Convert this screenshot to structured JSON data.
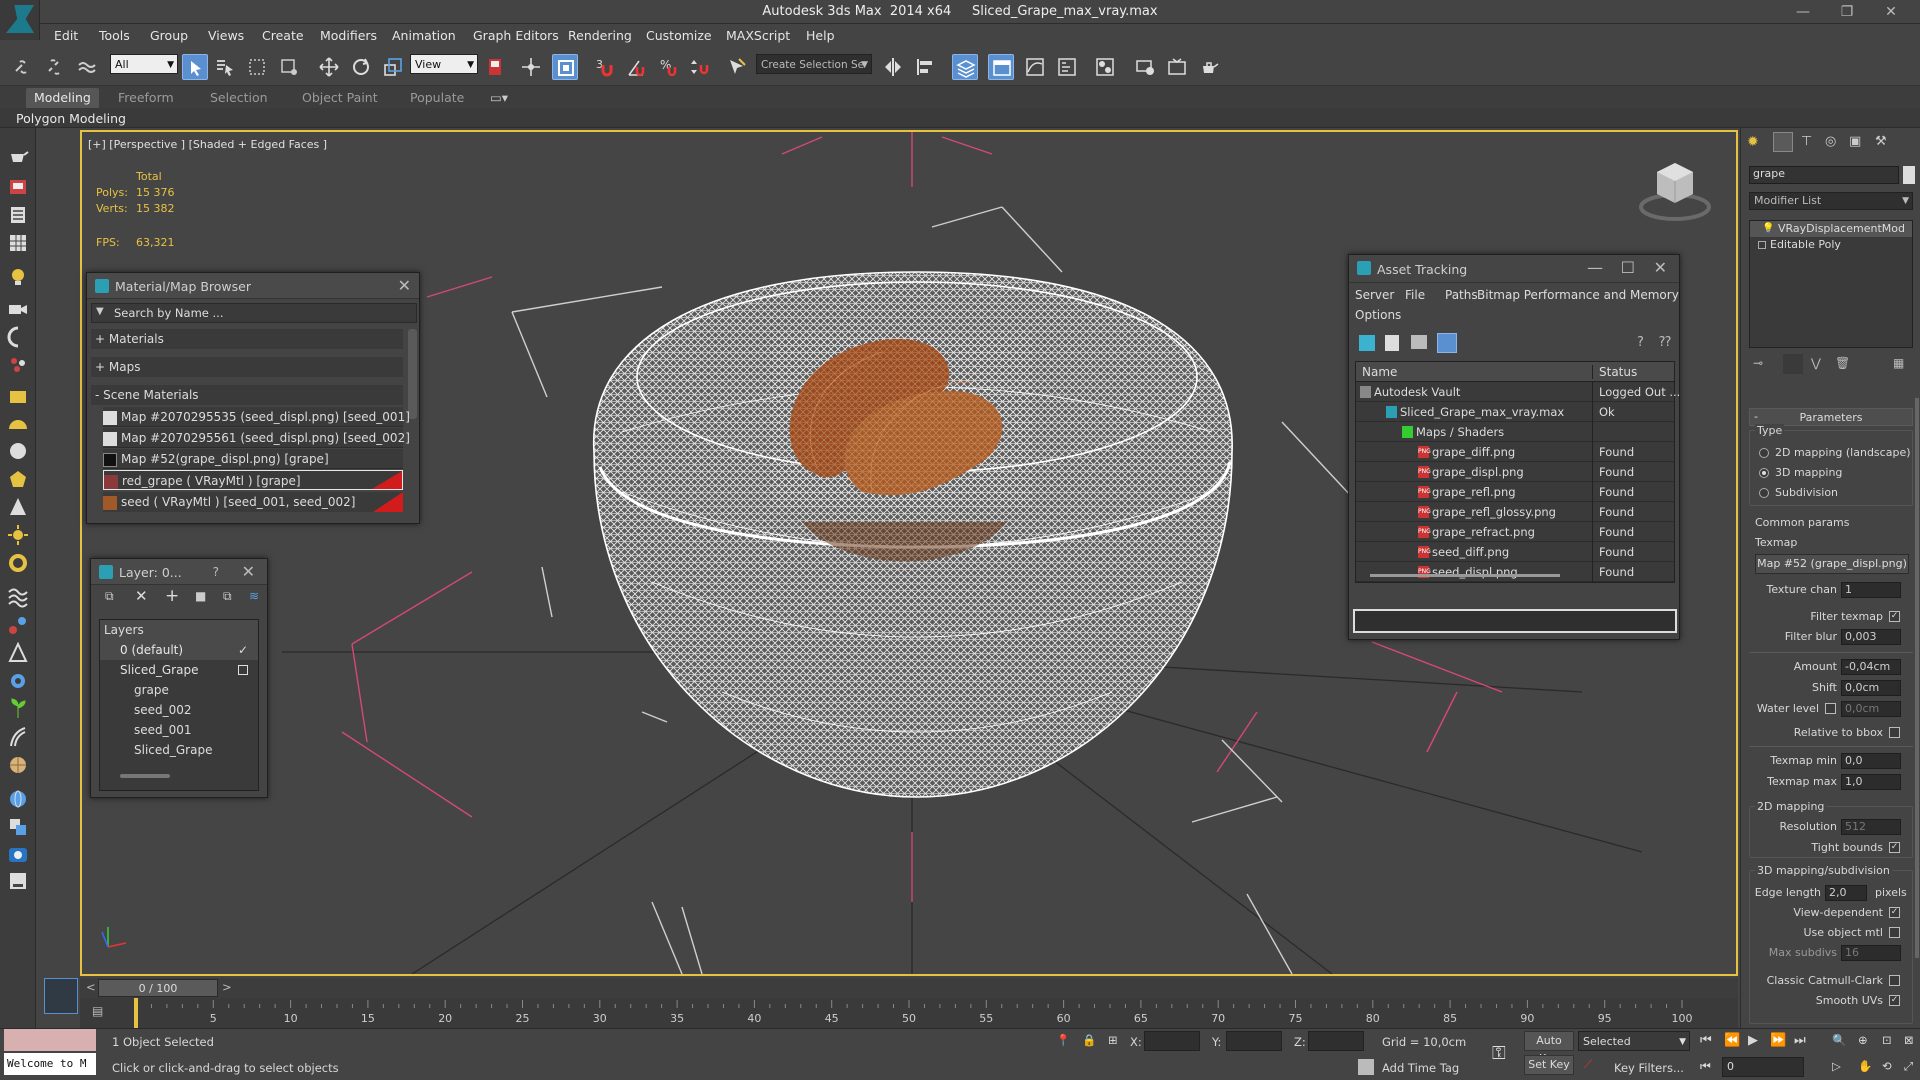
{
  "window": {
    "title": "Autodesk 3ds Max  2014 x64     Sliced_Grape_max_vray.max",
    "controls": [
      "—",
      "❐",
      "✕"
    ]
  },
  "menu": [
    "Edit",
    "Tools",
    "Group",
    "Views",
    "Create",
    "Modifiers",
    "Animation",
    "Graph Editors",
    "Rendering",
    "Customize",
    "MAXScript",
    "Help"
  ],
  "toolbar": {
    "filter_value": "All",
    "refcoord_value": "View",
    "selection_set_placeholder": "Create Selection Se",
    "angle_snap_label": "3",
    "percent_snap_label": "%"
  },
  "ribbon": {
    "tabs": [
      "Modeling",
      "Freeform",
      "Selection",
      "Object Paint",
      "Populate"
    ],
    "active": "Modeling",
    "panel_label": "Polygon Modeling"
  },
  "viewport": {
    "label": "[+] [Perspective ] [Shaded + Edged Faces ]",
    "stats_header": "Total",
    "polys_label": "Polys:",
    "polys_value": "15 376",
    "verts_label": "Verts:",
    "verts_value": "15 382",
    "fps_label": "FPS:",
    "fps_value": "63,321",
    "accent": "#e6c243",
    "wire_color": "#ffffff",
    "seed_color": "#9a4a1c"
  },
  "material_browser": {
    "title": "Material/Map Browser",
    "search_placeholder": "Search by Name ...",
    "groups": [
      "+ Materials",
      "+ Maps",
      "- Scene Materials"
    ],
    "items": [
      "Map #2070295535 (seed_displ.png) [seed_001]",
      "Map #2070295561 (seed_displ.png) [seed_002]",
      "Map #52(grape_displ.png) [grape]",
      "red_grape  ( VRayMtl ) [grape]",
      "seed  ( VRayMtl ) [seed_001, seed_002]"
    ]
  },
  "layer_manager": {
    "title": "Layer: 0...",
    "help": "?",
    "header": "Layers",
    "rows": [
      "0 (default)",
      "Sliced_Grape",
      "grape",
      "seed_002",
      "seed_001",
      "Sliced_Grape"
    ]
  },
  "asset_tracking": {
    "title": "Asset Tracking",
    "menu": [
      "Server",
      "File",
      "Paths",
      "Bitmap Performance and Memory",
      "Options"
    ],
    "columns": [
      "Name",
      "Status"
    ],
    "rows": [
      {
        "name": "Autodesk Vault",
        "status": "Logged Out ..."
      },
      {
        "name": "Sliced_Grape_max_vray.max",
        "status": "Ok"
      },
      {
        "name": "Maps / Shaders",
        "status": ""
      },
      {
        "name": "grape_diff.png",
        "status": "Found"
      },
      {
        "name": "grape_displ.png",
        "status": "Found"
      },
      {
        "name": "grape_refl.png",
        "status": "Found"
      },
      {
        "name": "grape_refl_glossy.png",
        "status": "Found"
      },
      {
        "name": "grape_refract.png",
        "status": "Found"
      },
      {
        "name": "seed_diff.png",
        "status": "Found"
      },
      {
        "name": "seed_displ.png",
        "status": "Found"
      }
    ],
    "file_badge": "PNG"
  },
  "command_panel": {
    "object_name": "grape",
    "modifier_list": "Modifier List",
    "stack": [
      "VRayDisplacementMod",
      "Editable Poly"
    ],
    "rollout_title": "Parameters",
    "type_label": "Type",
    "type_options": [
      "2D mapping (landscape)",
      "3D mapping",
      "Subdivision"
    ],
    "common_params": "Common params",
    "texmap_label": "Texmap",
    "texmap_value": "Map #52 (grape_displ.png)",
    "texture_chan_label": "Texture chan",
    "texture_chan_value": "1",
    "filter_texmap_label": "Filter texmap",
    "filter_blur_label": "Filter blur",
    "filter_blur_value": "0,003",
    "amount_label": "Amount",
    "amount_value": "-0,04cm",
    "shift_label": "Shift",
    "shift_value": "0,0cm",
    "water_level_label": "Water level",
    "water_level_value": "0,0cm",
    "relative_bbox_label": "Relative to bbox",
    "texmap_min_label": "Texmap min",
    "texmap_min_value": "0,0",
    "texmap_max_label": "Texmap max",
    "texmap_max_value": "1,0",
    "mapping2d_title": "2D mapping",
    "resolution_label": "Resolution",
    "resolution_value": "512",
    "tight_bounds_label": "Tight bounds",
    "mapping3d_title": "3D mapping/subdivision",
    "edge_length_label": "Edge length",
    "edge_length_value": "2,0",
    "pixels_label": "pixels",
    "view_dependent_label": "View-dependent",
    "use_object_mtl_label": "Use object mtl",
    "max_subdivs_label": "Max subdivs",
    "max_subdivs_value": "16",
    "classic_catmull_label": "Classic Catmull-Clark",
    "smooth_uvs_label": "Smooth UVs",
    "rollout_sign": "-"
  },
  "timeline": {
    "frame_display": "0 / 100",
    "ticks": [
      "5",
      "10",
      "15",
      "20",
      "25",
      "30",
      "35",
      "40",
      "45",
      "50",
      "55",
      "60",
      "65",
      "70",
      "75",
      "80",
      "85",
      "90",
      "95",
      "100"
    ]
  },
  "status": {
    "maxscript_listener": "Welcome to M",
    "selection": "1 Object Selected",
    "prompt": "Click or click-and-drag to select objects",
    "x_label": "X:",
    "y_label": "Y:",
    "z_label": "Z:",
    "grid": "Grid = 10,0cm",
    "add_time_tag": "Add Time Tag",
    "auto_key": "Auto Key",
    "set_key": "Set Key",
    "selected_value": "Selected",
    "key_filters": "Key Filters...",
    "frame_value": "0"
  }
}
